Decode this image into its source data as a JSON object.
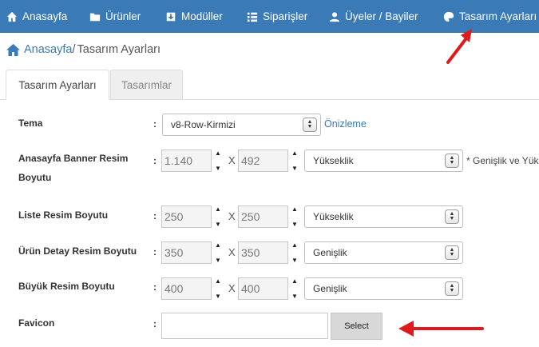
{
  "nav": {
    "items": [
      {
        "label": "Anasayfa",
        "icon": "home-icon"
      },
      {
        "label": "Ürünler",
        "icon": "folder-icon"
      },
      {
        "label": "Modüller",
        "icon": "inbox-icon"
      },
      {
        "label": "Siparişler",
        "icon": "list-icon"
      },
      {
        "label": "Üyeler / Bayiler",
        "icon": "user-icon"
      },
      {
        "label": "Tasarım Ayarları",
        "icon": "palette-icon"
      }
    ]
  },
  "breadcrumb": {
    "home": "Anasayfa",
    "separator": "/",
    "current": "Tasarım Ayarları"
  },
  "tabs": [
    {
      "label": "Tasarım Ayarları",
      "active": true
    },
    {
      "label": "Tasarımlar",
      "active": false
    }
  ],
  "form": {
    "colon": ":",
    "x_sign": "X",
    "tema": {
      "label": "Tema",
      "value": "v8-Row-Kirmizi",
      "preview_link": "Önizleme"
    },
    "banner": {
      "label_line1": "Anasayfa Banner Resim",
      "label_line2": "Boyutu",
      "width": "1.140",
      "height": "492",
      "mode": "Yükseklik",
      "note": "* Genişlik ve Yük"
    },
    "liste": {
      "label": "Liste Resim Boyutu",
      "width": "250",
      "height": "250",
      "mode": "Yükseklik"
    },
    "urun_detay": {
      "label": "Ürün Detay Resim Boyutu",
      "width": "350",
      "height": "350",
      "mode": "Genişlik"
    },
    "buyuk": {
      "label": "Büyük Resim Boyutu",
      "width": "400",
      "height": "400",
      "mode": "Genişlik"
    },
    "favicon": {
      "label": "Favicon",
      "button": "Select"
    }
  },
  "colors": {
    "nav_bg": "#3a7ab7",
    "link": "#3a7ab7",
    "annotation_arrow": "#e0191c"
  }
}
